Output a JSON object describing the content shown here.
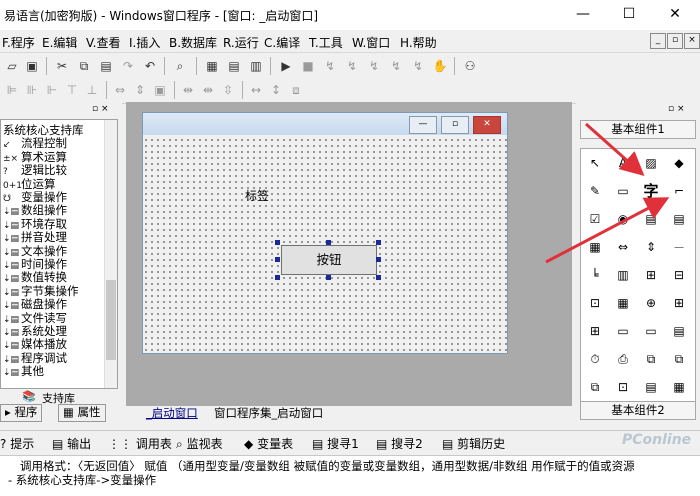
{
  "window": {
    "title": "易语言(加密狗版) - Windows窗口程序 - [窗口: _启动窗口]",
    "minimize": "—",
    "maximize": "☐",
    "close": "✕"
  },
  "menu": {
    "items": [
      "F.程序",
      "E.编辑",
      "V.查看",
      "I.插入",
      "B.数据库",
      "R.运行",
      "C.编译",
      "T.工具",
      "W.窗口",
      "H.帮助"
    ],
    "mdi_controls": [
      "_",
      "▫",
      "×"
    ]
  },
  "left_panel": {
    "tree_items": [
      {
        "icon": "",
        "label": "系统核心支持库"
      },
      {
        "icon": "↙",
        "label": "流程控制"
      },
      {
        "icon": "±×",
        "label": "算术运算"
      },
      {
        "icon": "?",
        "label": "逻辑比较"
      },
      {
        "icon": "0+1",
        "label": "位运算"
      },
      {
        "icon": "☋",
        "label": "变量操作"
      },
      {
        "icon": "⇣▤",
        "label": "数组操作"
      },
      {
        "icon": "⇣▤",
        "label": "环境存取"
      },
      {
        "icon": "⇣▤",
        "label": "拼音处理"
      },
      {
        "icon": "⇣▤",
        "label": "文本操作"
      },
      {
        "icon": "⇣▤",
        "label": "时间操作"
      },
      {
        "icon": "⇣▤",
        "label": "数值转换"
      },
      {
        "icon": "⇣▤",
        "label": "字节集操作"
      },
      {
        "icon": "⇣▤",
        "label": "磁盘操作"
      },
      {
        "icon": "⇣▤",
        "label": "文件读写"
      },
      {
        "icon": "⇣▤",
        "label": "系统处理"
      },
      {
        "icon": "⇣▤",
        "label": "媒体播放"
      },
      {
        "icon": "⇣▤",
        "label": "程序调试"
      },
      {
        "icon": "⇣▤",
        "label": "其他"
      }
    ],
    "lib_tab": "支持库",
    "tabs": [
      "程序",
      "属性"
    ]
  },
  "design": {
    "label_text": "标签",
    "button_text": "按钮",
    "tabs": [
      "_启动窗口",
      "窗口程序集_启动窗口"
    ]
  },
  "right_panel": {
    "header_top": "基本组件1",
    "header_bottom": "基本组件2",
    "components": [
      "↖",
      "A",
      "▨",
      "◆",
      "✎",
      "▭",
      "字",
      "⌐",
      "☑",
      "◉",
      "▤",
      "▤",
      "▦",
      "⇔",
      "⇕",
      "⏤",
      "╘",
      "▥",
      "⊞",
      "⊟",
      "⊡",
      "▦",
      "⊕",
      "⊞",
      "⊞",
      "▭",
      "▭",
      "▤",
      "⏱",
      "⎙",
      "⧉",
      "⧉",
      "⧉",
      "⊡",
      "▤",
      "▦"
    ]
  },
  "bottom": {
    "tabs": [
      "提示",
      "输出",
      "调用表",
      "监视表",
      "变量表",
      "搜寻1",
      "搜寻2",
      "剪辑历史"
    ],
    "output_lines": [
      "调用格式：〈无返回值〉 赋值 （通用型变量/变量数组 被赋值的变量或变量数组，通用型数据/非数组 用作赋于的值或资源",
      "- 系统核心支持库->变量操作"
    ],
    "watermark": "PConline"
  },
  "colors": {
    "design_bg": "#abaaab",
    "arrow": "#e0313b",
    "handle": "#1a2a9a"
  }
}
